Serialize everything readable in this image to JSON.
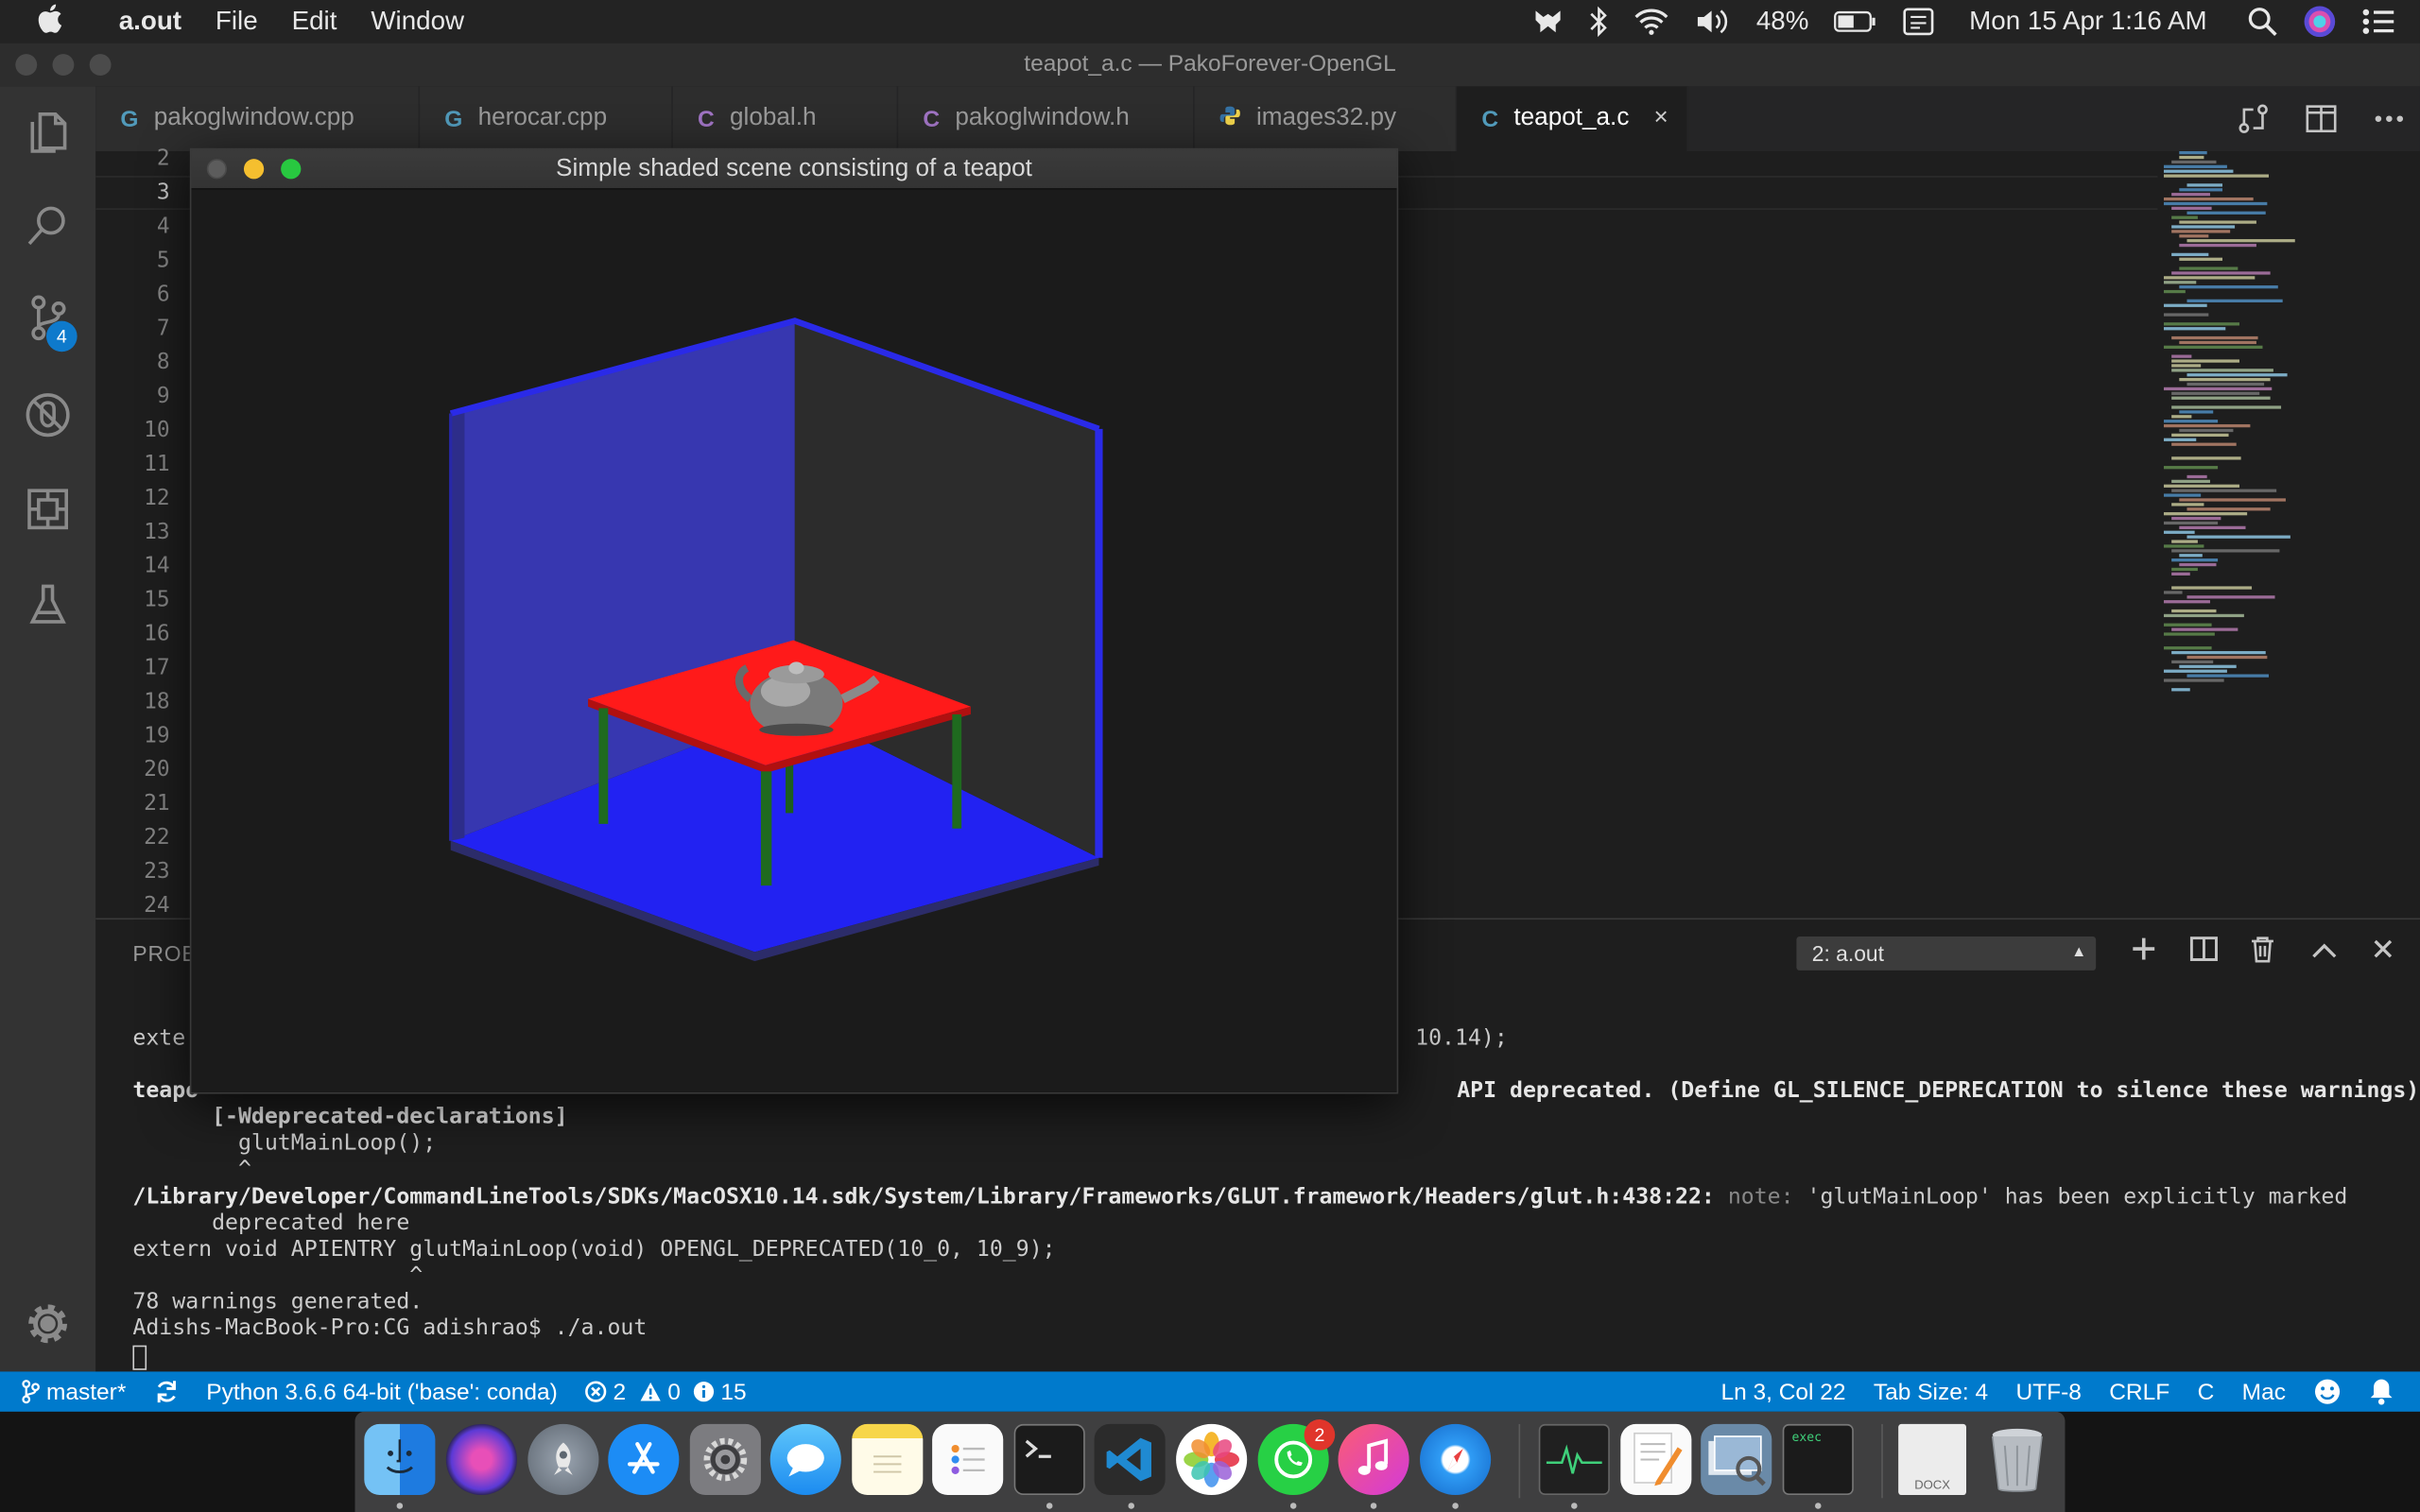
{
  "menubar": {
    "app": "a.out",
    "menus": [
      "File",
      "Edit",
      "Window"
    ],
    "battery": "48%",
    "datetime": "Mon 15 Apr  1:16 AM"
  },
  "window": {
    "title": "teapot_a.c — PakoForever-OpenGL"
  },
  "activity": {
    "source_control_badge": "4"
  },
  "tabs": [
    {
      "lang": "G",
      "label": "pakoglwindow.cpp",
      "icon": "cpp-file-icon"
    },
    {
      "lang": "G",
      "label": "herocar.cpp",
      "icon": "cpp-file-icon"
    },
    {
      "lang": "C",
      "label": "global.h",
      "icon": "c-file-icon"
    },
    {
      "lang": "C",
      "label": "pakoglwindow.h",
      "icon": "c-file-icon"
    },
    {
      "lang": "",
      "label": "images32.py",
      "icon": "python-file-icon"
    },
    {
      "lang": "C",
      "label": "teapot_a.c",
      "icon": "c-file-icon",
      "close": "×"
    }
  ],
  "editor": {
    "line_numbers": [
      "2",
      "3",
      "4",
      "5",
      "6",
      "7",
      "8",
      "9",
      "10",
      "11",
      "12",
      "13",
      "14",
      "15",
      "16",
      "17",
      "18",
      "19",
      "20",
      "21",
      "22",
      "23",
      "24"
    ],
    "current_line": "3"
  },
  "gl_window": {
    "title": "Simple shaded scene consisting of a teapot"
  },
  "panel": {
    "title": "PROB",
    "terminal_select": "2: a.out",
    "lines": {
      "l1a": "exte",
      "l1b": "10.14);",
      "l2a": "teapo",
      "l2b": "API deprecated. (Define GL_SILENCE_DEPRECATION to silence these warnings)",
      "l3": "      [-Wdeprecated-declarations]",
      "l4": "        glutMainLoop();",
      "l5": "        ^",
      "l6_path": "/Library/Developer/CommandLineTools/SDKs/MacOSX10.14.sdk/System/Library/Frameworks/GLUT.framework/Headers/glut.h:438:22:",
      "l6_note": "note:",
      "l6_msg": "'glutMainLoop' has been explicitly marked",
      "l7": "      deprecated here",
      "l8": "extern void APIENTRY glutMainLoop(void) OPENGL_DEPRECATED(10_0, 10_9);",
      "l9": "                     ^",
      "l10": "78 warnings generated.",
      "l11": "Adishs-MacBook-Pro:CG adishrao$ ./a.out"
    }
  },
  "statusbar": {
    "branch": "master*",
    "python": "Python 3.6.6 64-bit ('base': conda)",
    "errors": "2",
    "warnings": "0",
    "infos": "15",
    "position": "Ln 3, Col 22",
    "tabsize": "Tab Size: 4",
    "encoding": "UTF-8",
    "eol": "CRLF",
    "language": "C",
    "platform": "Mac"
  },
  "dock": {
    "items": [
      "Finder",
      "Siri",
      "Launchpad",
      "App Store",
      "System Preferences",
      "Messages",
      "Notes",
      "Reminders",
      "Terminal",
      "Visual Studio Code",
      "Photos",
      "WhatsApp",
      "iTunes",
      "Safari",
      "Activity Monitor",
      "Pages",
      "Preview",
      "exec",
      "DOCX",
      "Trash"
    ],
    "whatsapp_badge": "2",
    "exec_label": "exec",
    "docx_label": "DOCX"
  },
  "colors": {
    "accent": "#007acc",
    "badge": "#0e7acc",
    "floor": "#2121f0",
    "table": "#ff1a1a",
    "legs": "#1f6a1f"
  }
}
